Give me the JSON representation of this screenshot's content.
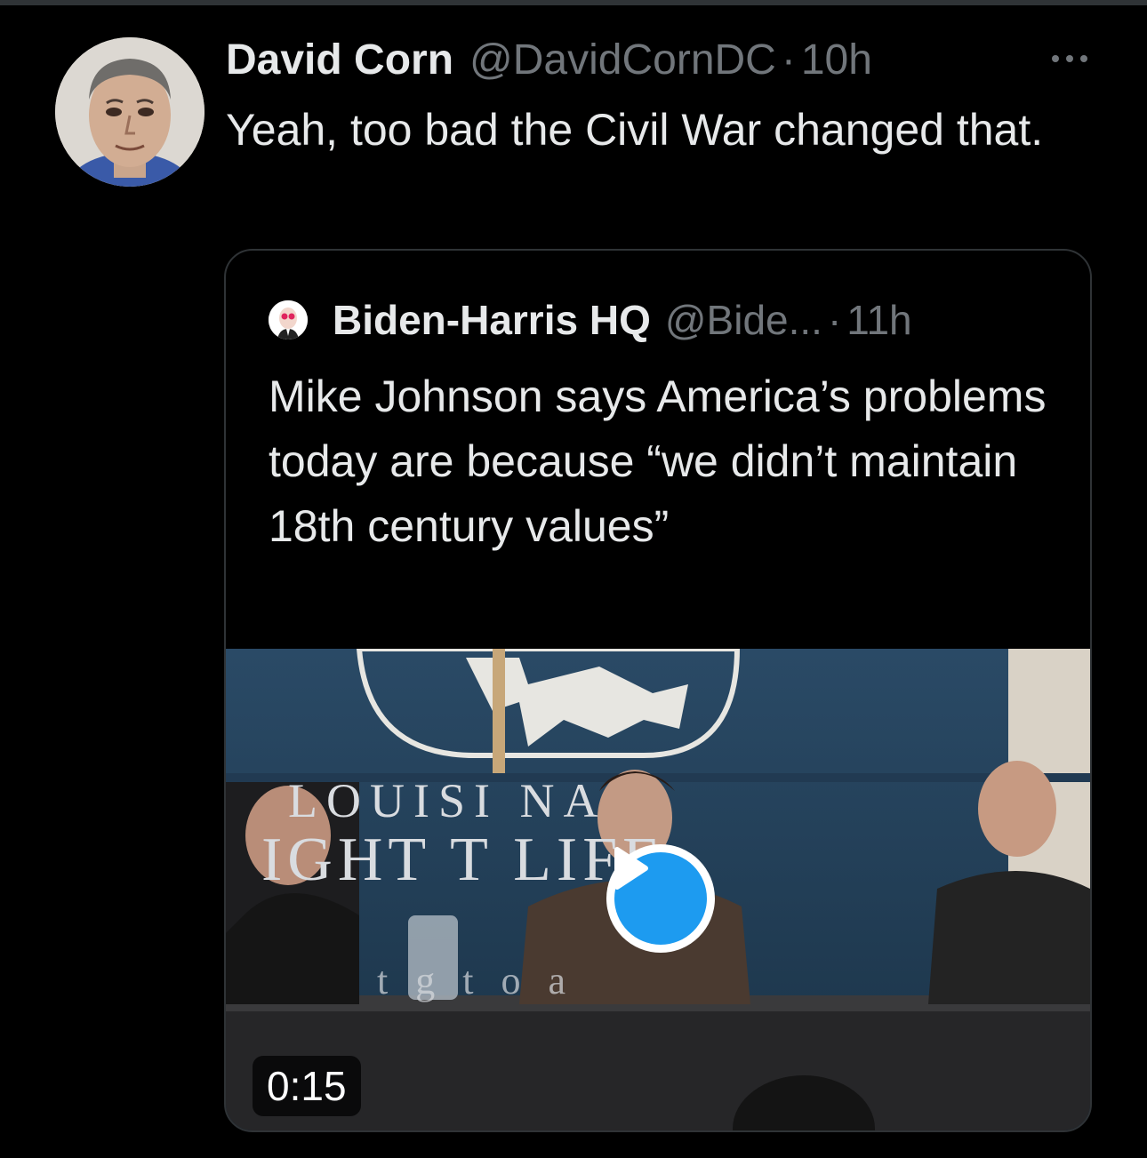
{
  "tweet": {
    "display_name": "David Corn",
    "handle": "@DavidCornDC",
    "separator": "·",
    "time": "10h",
    "text": "Yeah, too bad the Civil War changed that.",
    "more_icon": "more-horizontal-icon"
  },
  "quoted_tweet": {
    "display_name": "Biden-Harris HQ",
    "handle": "@Bide...",
    "separator": "·",
    "time": "11h",
    "text": "Mike Johnson says America’s problems today are because “we didn’t maintain 18th century values”",
    "media": {
      "type": "video",
      "duration": "0:15",
      "play_icon": "play-icon",
      "sign_line1": "LOUISI  NA",
      "sign_line2": "IGHT T  LIFE",
      "sign_line3": "t  g t       o a"
    }
  },
  "colors": {
    "background": "#000000",
    "primary_text": "#e7e9ea",
    "secondary_text": "#71767b",
    "border": "#2f3336",
    "accent": "#1d9bf0"
  }
}
